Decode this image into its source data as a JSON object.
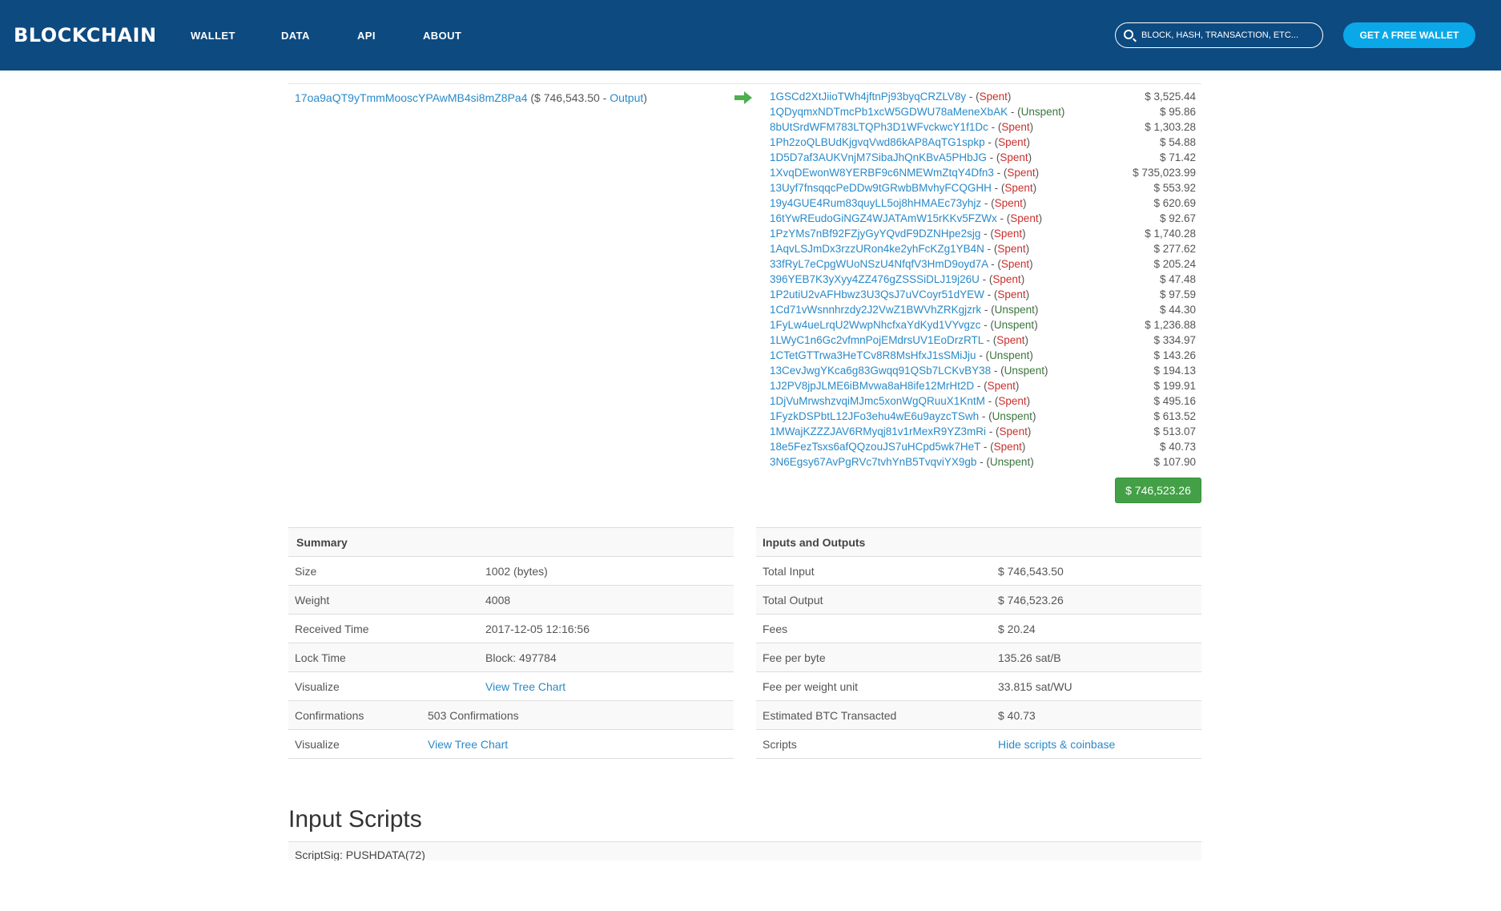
{
  "header": {
    "brand": "BLOCKCHAIN",
    "nav": [
      "WALLET",
      "DATA",
      "API",
      "ABOUT"
    ],
    "search_placeholder": "BLOCK, HASH, TRANSACTION, ETC...",
    "cta_label": "GET A FREE WALLET",
    "colors": {
      "bar": "#0d4a80",
      "cta": "#0aa8e8"
    }
  },
  "transaction": {
    "input_address": "17oa9aQT9yTmmMooscYPAwMB4si8mZ8Pa4",
    "input_amount_prefix": "($ 746,543.50 - ",
    "input_output_link": "Output",
    "input_amount_suffix": ")",
    "arrow_icon": "right-arrow-icon",
    "outputs": [
      {
        "address": "1GSCd2XtJiioTWh4jftnPj93byqCRZLV8y",
        "status": "Spent",
        "amount": "$ 3,525.44"
      },
      {
        "address": "1QDyqmxNDTmcPb1xcW5GDWU78aMeneXbAK",
        "status": "Unspent",
        "amount": "$ 95.86"
      },
      {
        "address": "8bUtSrdWFM783LTQPh3D1WFvckwcY1f1Dc",
        "status": "Spent",
        "amount": "$ 1,303.28"
      },
      {
        "address": "1Ph2zoQLBUdKjgvqVwd86kAP8AqTG1spkp",
        "status": "Spent",
        "amount": "$ 54.88"
      },
      {
        "address": "1D5D7af3AUKVnjM7SibaJhQnKBvA5PHbJG",
        "status": "Spent",
        "amount": "$ 71.42"
      },
      {
        "address": "1XvqDEwonW8YERBF9c6NMEWmZtqY4Dfn3",
        "status": "Spent",
        "amount": "$ 735,023.99"
      },
      {
        "address": "13Uyf7fnsqqcPeDDw9tGRwbBMvhyFCQGHH",
        "status": "Spent",
        "amount": "$ 553.92"
      },
      {
        "address": "19y4GUE4Rum83quyLL5oj8hHMAEc73yhjz",
        "status": "Spent",
        "amount": "$ 620.69"
      },
      {
        "address": "16tYwREudoGiNGZ4WJATAmW15rKKv5FZWx",
        "status": "Spent",
        "amount": "$ 92.67"
      },
      {
        "address": "1PzYMs7nBf92FZjyGyYQvdF9DZNHpe2sjg",
        "status": "Spent",
        "amount": "$ 1,740.28"
      },
      {
        "address": "1AqvLSJmDx3rzzURon4ke2yhFcKZg1YB4N",
        "status": "Spent",
        "amount": "$ 277.62"
      },
      {
        "address": "33fRyL7eCpgWUoNSzU4NfqfV3HmD9oyd7A",
        "status": "Spent",
        "amount": "$ 205.24"
      },
      {
        "address": "396YEB7K3yXyy4ZZ476gZSSSiDLJ19j26U",
        "status": "Spent",
        "amount": "$ 47.48"
      },
      {
        "address": "1P2utiU2vAFHbwz3U3QsJ7uVCoyr51dYEW",
        "status": "Spent",
        "amount": "$ 97.59"
      },
      {
        "address": "1Cd71vWsnnhrzdy2J2VwZ1BWVhZRKgjzrk",
        "status": "Unspent",
        "amount": "$ 44.30"
      },
      {
        "address": "1FyLw4ueLrqU2WwpNhcfxaYdKyd1VYvgzc",
        "status": "Unspent",
        "amount": "$ 1,236.88"
      },
      {
        "address": "1LWyC1n6Gc2vfmnPojEMdrsUV1EoDrzRTL",
        "status": "Spent",
        "amount": "$ 334.97"
      },
      {
        "address": "1CTetGTTrwa3HeTCv8R8MsHfxJ1sSMiJju",
        "status": "Unspent",
        "amount": "$ 143.26"
      },
      {
        "address": "13CevJwgYKca6g83Gwqq91QSb7LCKvBY38",
        "status": "Unspent",
        "amount": "$ 194.13"
      },
      {
        "address": "1J2PV8jpJLME6iBMvwa8aH8ife12MrHt2D",
        "status": "Spent",
        "amount": "$ 199.91"
      },
      {
        "address": "1DjVuMrwshzvqiMJmc5xonWgQRuuX1KntM",
        "status": "Spent",
        "amount": "$ 495.16"
      },
      {
        "address": "1FyzkDSPbtL12JFo3ehu4wE6u9ayzcTSwh",
        "status": "Unspent",
        "amount": "$ 613.52"
      },
      {
        "address": "1MWajKZZZJAV6RMyqj81v1rMexR9YZ3mRi",
        "status": "Spent",
        "amount": "$ 513.07"
      },
      {
        "address": "18e5FezTsxs6afQQzouJS7uHCpd5wk7HeT",
        "status": "Spent",
        "amount": "$ 40.73"
      },
      {
        "address": "3N6Egsy67AvPgRVc7tvhYnB5TvqviYX9gb",
        "status": "Unspent",
        "amount": "$ 107.90"
      }
    ],
    "total_output": "$ 746,523.26",
    "colors": {
      "spent": "#c9302c",
      "unspent": "#3c763d",
      "total_badge": "#43a047"
    }
  },
  "summary": {
    "title": "Summary",
    "rows": [
      {
        "label": "Size",
        "value": "1002 (bytes)"
      },
      {
        "label": "Weight",
        "value": "4008"
      },
      {
        "label": "Received Time",
        "value": "2017-12-05 12:16:56"
      },
      {
        "label": "Lock Time",
        "value": "Block: 497784"
      },
      {
        "label": "Visualize",
        "value": "View Tree Chart"
      },
      {
        "label": "Confirmations",
        "value": "503 Confirmations"
      },
      {
        "label": "Visualize",
        "value": "View Tree Chart"
      }
    ]
  },
  "io": {
    "title": "Inputs and Outputs",
    "rows": [
      {
        "label": "Total Input",
        "value": "$ 746,543.50"
      },
      {
        "label": "Total Output",
        "value": "$ 746,523.26"
      },
      {
        "label": "Fees",
        "value": "$ 20.24"
      },
      {
        "label": "Fee per byte",
        "value": "135.26 sat/B"
      },
      {
        "label": "Fee per weight unit",
        "value": "33.815 sat/WU"
      },
      {
        "label": "Estimated BTC Transacted",
        "value": "$ 40.73"
      },
      {
        "label": "Scripts",
        "value": "Hide scripts & coinbase"
      }
    ]
  },
  "input_scripts": {
    "title": "Input Scripts",
    "first_line": "ScriptSig: PUSHDATA(72)"
  }
}
